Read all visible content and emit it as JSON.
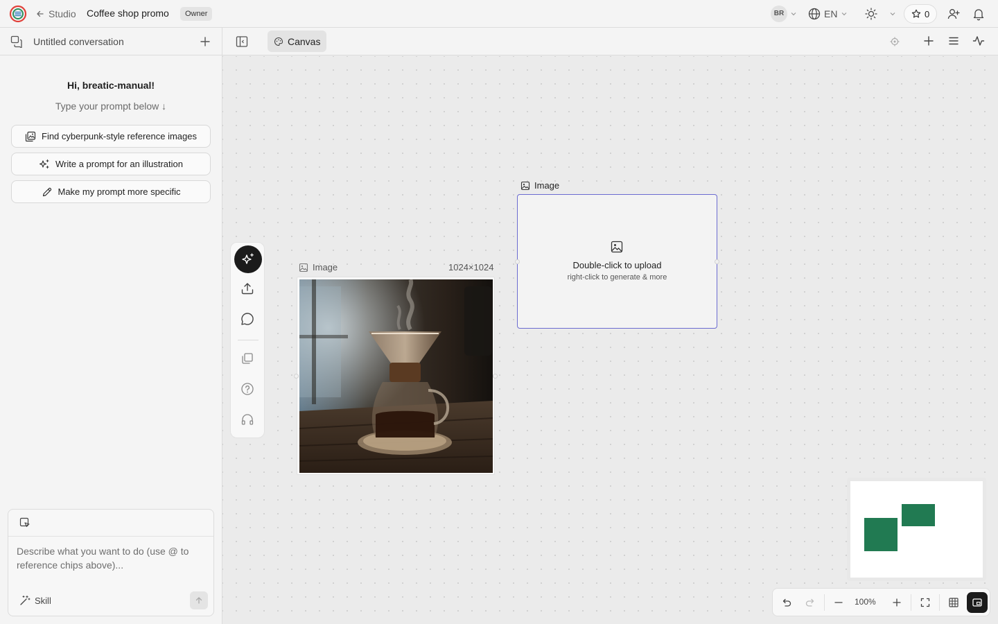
{
  "topbar": {
    "back_label": "Studio",
    "project_title": "Coffee shop promo",
    "role_badge": "Owner",
    "avatar_initials": "BR",
    "language": "EN",
    "star_count": "0",
    "logo_colors": {
      "outer": "#e0413a",
      "inner": "#2a8f5c"
    }
  },
  "sidebar": {
    "conversation_title": "Untitled conversation",
    "greeting": "Hi, breatic-manual!",
    "subtitle": "Type your prompt below ↓",
    "suggestions": [
      {
        "label": "Find cyberpunk-style reference images",
        "icon": "image-search-icon"
      },
      {
        "label": "Write a prompt for an illustration",
        "icon": "sparkles-icon"
      },
      {
        "label": "Make my prompt more specific",
        "icon": "pencil-icon"
      }
    ],
    "composer": {
      "placeholder": "Describe what you want to do (use @ to reference chips above)...",
      "skill_label": "Skill"
    }
  },
  "canvas_header": {
    "tab_label": "Canvas"
  },
  "canvas": {
    "nodes": [
      {
        "label": "Image",
        "size": "1024×1024",
        "state": "filled"
      },
      {
        "label": "Image",
        "upload_text": "Double-click to upload",
        "upload_hint": "right-click to generate & more",
        "state": "empty"
      }
    ],
    "zoom": "100%",
    "minimap_color": "#217a52",
    "selection_color": "#6a6ad0"
  }
}
